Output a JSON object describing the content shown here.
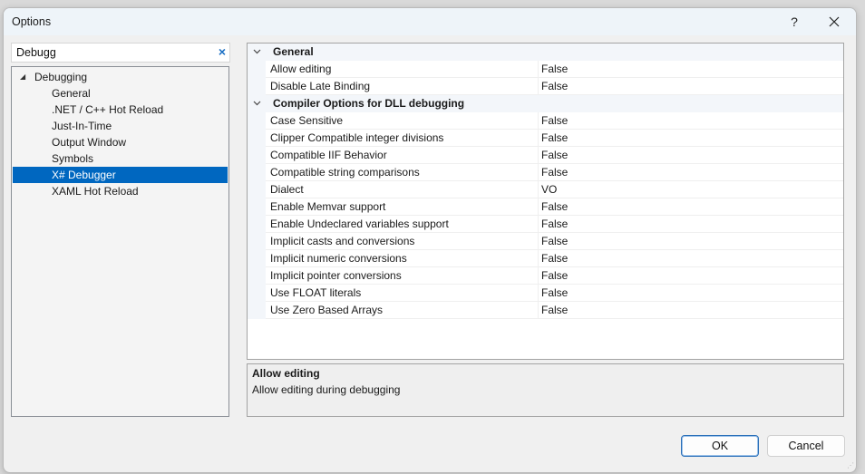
{
  "window": {
    "title": "Options",
    "help_label": "?",
    "close_label": "✕"
  },
  "search": {
    "value": "Debugg",
    "clear_icon": "×"
  },
  "tree": {
    "root": {
      "label": "Debugging",
      "expanded": true,
      "caret": "◢"
    },
    "items": [
      {
        "label": "General",
        "selected": false
      },
      {
        "label": ".NET / C++ Hot Reload",
        "selected": false
      },
      {
        "label": "Just-In-Time",
        "selected": false
      },
      {
        "label": "Output Window",
        "selected": false
      },
      {
        "label": "Symbols",
        "selected": false
      },
      {
        "label": "X# Debugger",
        "selected": true
      },
      {
        "label": "XAML Hot Reload",
        "selected": false
      }
    ]
  },
  "property_grid": {
    "categories": [
      {
        "label": "General",
        "caret": "⌄",
        "properties": [
          {
            "name": "Allow editing",
            "value": "False"
          },
          {
            "name": "Disable Late Binding",
            "value": "False"
          }
        ]
      },
      {
        "label": "Compiler Options for DLL debugging",
        "caret": "⌄",
        "properties": [
          {
            "name": "Case Sensitive",
            "value": "False"
          },
          {
            "name": "Clipper Compatible integer divisions",
            "value": "False"
          },
          {
            "name": "Compatible IIF Behavior",
            "value": "False"
          },
          {
            "name": "Compatible string comparisons",
            "value": "False"
          },
          {
            "name": "Dialect",
            "value": "VO"
          },
          {
            "name": "Enable Memvar support",
            "value": "False"
          },
          {
            "name": "Enable Undeclared variables support",
            "value": "False"
          },
          {
            "name": "Implicit casts and conversions",
            "value": "False"
          },
          {
            "name": "Implicit numeric conversions",
            "value": "False"
          },
          {
            "name": "Implicit pointer conversions",
            "value": "False"
          },
          {
            "name": "Use FLOAT literals",
            "value": "False"
          },
          {
            "name": "Use Zero Based Arrays",
            "value": "False"
          }
        ]
      }
    ]
  },
  "description": {
    "title": "Allow editing",
    "text": "Allow editing during debugging"
  },
  "buttons": {
    "ok": "OK",
    "cancel": "Cancel"
  },
  "colors": {
    "selection": "#0067c0",
    "clear_icon": "#1a6fc4"
  }
}
